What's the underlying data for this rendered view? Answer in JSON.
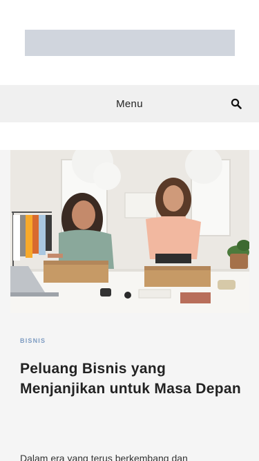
{
  "nav": {
    "menu_label": "Menu",
    "search_icon": "search-icon"
  },
  "post": {
    "category": "BISNIS",
    "title": "Peluang Bisnis yang Menjanjikan untuk Masa Depan",
    "excerpt": "Dalam era yang terus berkembang dan"
  },
  "colors": {
    "logo_placeholder": "#d0d5dd",
    "nav_bg": "#f0f0f0",
    "content_bg": "#f5f5f5",
    "category": "#7d9bc1"
  }
}
